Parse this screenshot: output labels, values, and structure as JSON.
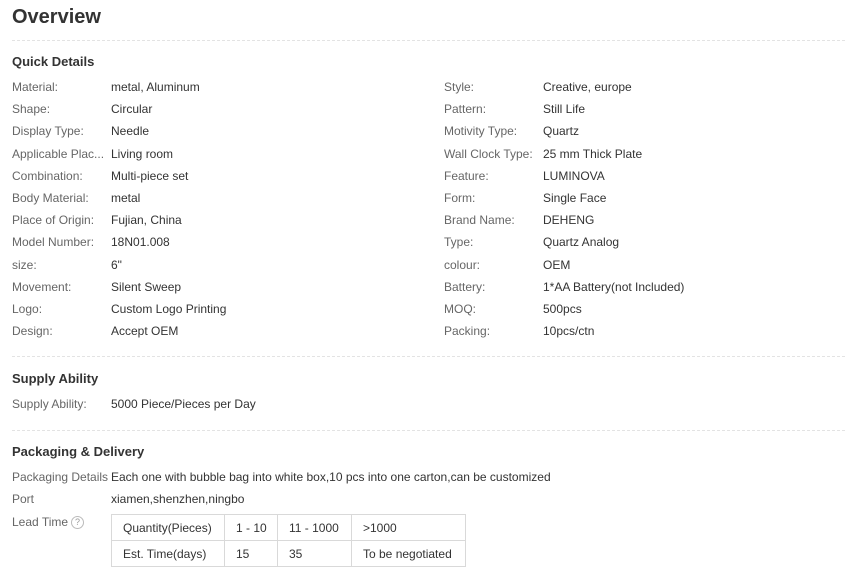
{
  "page_title": "Overview",
  "quick_details": {
    "title": "Quick Details",
    "left": [
      {
        "label": "Material:",
        "value": "metal, Aluminum"
      },
      {
        "label": "Shape:",
        "value": "Circular"
      },
      {
        "label": "Display Type:",
        "value": "Needle"
      },
      {
        "label": "Applicable Plac...",
        "value": "Living room"
      },
      {
        "label": "Combination:",
        "value": "Multi-piece set"
      },
      {
        "label": "Body Material:",
        "value": "metal"
      },
      {
        "label": "Place of Origin:",
        "value": "Fujian, China"
      },
      {
        "label": "Model Number:",
        "value": "18N01.008"
      },
      {
        "label": "size:",
        "value": "6\""
      },
      {
        "label": "Movement:",
        "value": "Silent Sweep"
      },
      {
        "label": "Logo:",
        "value": "Custom Logo Printing"
      },
      {
        "label": "Design:",
        "value": "Accept OEM"
      }
    ],
    "right": [
      {
        "label": "Style:",
        "value": "Creative, europe"
      },
      {
        "label": "Pattern:",
        "value": "Still Life"
      },
      {
        "label": "Motivity Type:",
        "value": "Quartz"
      },
      {
        "label": "Wall Clock Type:",
        "value": "25 mm Thick Plate"
      },
      {
        "label": "Feature:",
        "value": "LUMINOVA"
      },
      {
        "label": "Form:",
        "value": "Single Face"
      },
      {
        "label": "Brand Name:",
        "value": "DEHENG"
      },
      {
        "label": "Type:",
        "value": "Quartz Analog"
      },
      {
        "label": "colour:",
        "value": "OEM"
      },
      {
        "label": "Battery:",
        "value": "1*AA Battery(not Included)"
      },
      {
        "label": "MOQ:",
        "value": "500pcs"
      },
      {
        "label": "Packing:",
        "value": "10pcs/ctn"
      }
    ]
  },
  "supply_ability": {
    "title": "Supply Ability",
    "label": "Supply Ability:",
    "value": "5000 Piece/Pieces per Day"
  },
  "packaging_delivery": {
    "title": "Packaging & Delivery",
    "packaging_details_label": "Packaging Details",
    "packaging_details_value": "Each one with bubble bag into white box,10 pcs into one carton,can be customized",
    "port_label": "Port",
    "port_value": "xiamen,shenzhen,ningbo",
    "lead_time_label": "Lead Time",
    "lead_time_help_icon": "question-circle-icon",
    "lead_time_table": {
      "rows": [
        [
          "Quantity(Pieces)",
          "1 - 10",
          "11 - 1000",
          ">1000"
        ],
        [
          "Est. Time(days)",
          "15",
          "35",
          "To be negotiated"
        ]
      ]
    }
  }
}
